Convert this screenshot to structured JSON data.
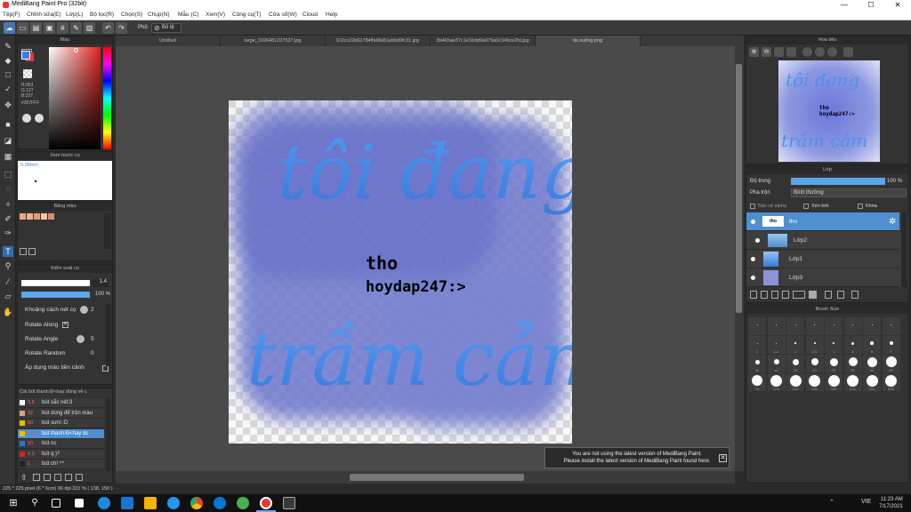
{
  "window": {
    "title": "MediBang Paint Pro (32bit)",
    "minimize": "—",
    "maximize": "☐",
    "close": "✕"
  },
  "menu": [
    "Tệp(F)",
    "Chỉnh sửa(E)",
    "Lớp(L)",
    "Bộ lọc(R)",
    "Chọn(S)",
    "Chụp(N)",
    "Mẫu (C)",
    "Xem(V)",
    "Công cụ(T)",
    "Cửa sổ(W)",
    "Cloud",
    "Help"
  ],
  "toolbar": {
    "brush_mode": "Phủ",
    "deselect": "Bỏ lệ",
    "undo": "↶",
    "redo": "↷"
  },
  "tabs": [
    "Untitled",
    "large_1026481227537.jpg",
    "9J2cc22b61784ffa9fa81ab9d9fc31.jpg",
    "3b465ae37c1e32dd9a975a0c349ce2fd.jpg",
    "tải xuống.png"
  ],
  "color_panel": {
    "title": "Màu",
    "r": "R:053",
    "g": "G:127",
    "b": "B:237",
    "hex": "#357FFF",
    "fg_color": "#357fed",
    "bg_color": "#ffffff"
  },
  "brush_preview": {
    "title": "Xem trước cọ",
    "size": "0.38mm"
  },
  "palette": {
    "title": "Bảng màu",
    "swatches": [
      "#e8a98a",
      "#f0b58e",
      "#e79a75",
      "#f2c8a6",
      "#d98f6f"
    ]
  },
  "brush_control": {
    "title": "Kiểm soát cọ",
    "size_value": "1.4",
    "opacity_value": "100 %",
    "spacing_label": "Khoảng cách nét cọ",
    "spacing_value": "2",
    "rotate_along": "Rotate Along",
    "rotate_angle": "Rotate Angle",
    "rotate_angle_value": "5",
    "rotate_random": "Rotate Random",
    "rotate_random_value": "0",
    "apply_color": "Áp dụng màu tiền cảnh"
  },
  "brush_list": {
    "title": "Cài bút thanh:Đ<hay dùng về c",
    "items": [
      {
        "size": "3.8",
        "name": "bút sắc nét:3",
        "color": "#ffffff"
      },
      {
        "size": "32",
        "name": "bút dùng để trộn màu",
        "color": "#e0a080"
      },
      {
        "size": "50",
        "name": "bút sưni :D",
        "color": "#e6c200"
      },
      {
        "size": "1.4",
        "name": "bút thanh:Đ<hay dc",
        "color": "#e6c200"
      },
      {
        "size": "50",
        "name": "bút nc",
        "color": "#2a73c9"
      },
      {
        "size": "6.3",
        "name": "bút q:)?",
        "color": "#cc2222"
      },
      {
        "size": "1",
        "name": "bút chì ^^",
        "color": "#222222"
      }
    ]
  },
  "canvas_text": {
    "script_top": "tôi đang",
    "script_bottom": "trầm cảm",
    "line1": "tho",
    "line2": "hoydap247:>"
  },
  "navigator": {
    "title": "Hoa tiêu"
  },
  "layer_panel": {
    "title": "Lớp",
    "opacity_label": "Độ trong",
    "opacity_value": "100 %",
    "blend_label": "Pha trộn",
    "blend_value": "Bình thường",
    "protect_alpha": "Bảo vệ alpha",
    "clipping": "Xén bớt",
    "lock": "Khóa",
    "layers": [
      {
        "name": "tho",
        "selected": true
      },
      {
        "name": "Lớp2",
        "selected": false
      },
      {
        "name": "Lớp1",
        "selected": false
      },
      {
        "name": "Lớp3",
        "selected": false
      }
    ]
  },
  "brush_size": {
    "title": "Brush Size",
    "labels_row2": [
      "1",
      "1.5",
      "2",
      "2.5",
      "3",
      "4",
      "5",
      "7"
    ],
    "labels_row3": [
      "10",
      "12",
      "15",
      "20",
      "25",
      "30",
      "40",
      "50"
    ],
    "labels_row4": [
      "70",
      "100",
      "150",
      "200",
      "250",
      "300",
      "400",
      "500"
    ]
  },
  "notification": {
    "line1": "You are not using the latest version of MediBang Paint.",
    "line2": "Please install the latest version of MediBang Paint found here.",
    "close": "✕"
  },
  "status_bar": {
    "text": "225 * 225 pixel  (6 * 6cm)  96 dpi  321 %  ( 138, 150 )"
  },
  "taskbar": {
    "time": "11:23 AM",
    "date": "7/17/2021",
    "lang": "VIE"
  },
  "colors": {
    "accent": "#4f8fd0",
    "panel": "#333333",
    "workspace": "#4a4a4a"
  }
}
